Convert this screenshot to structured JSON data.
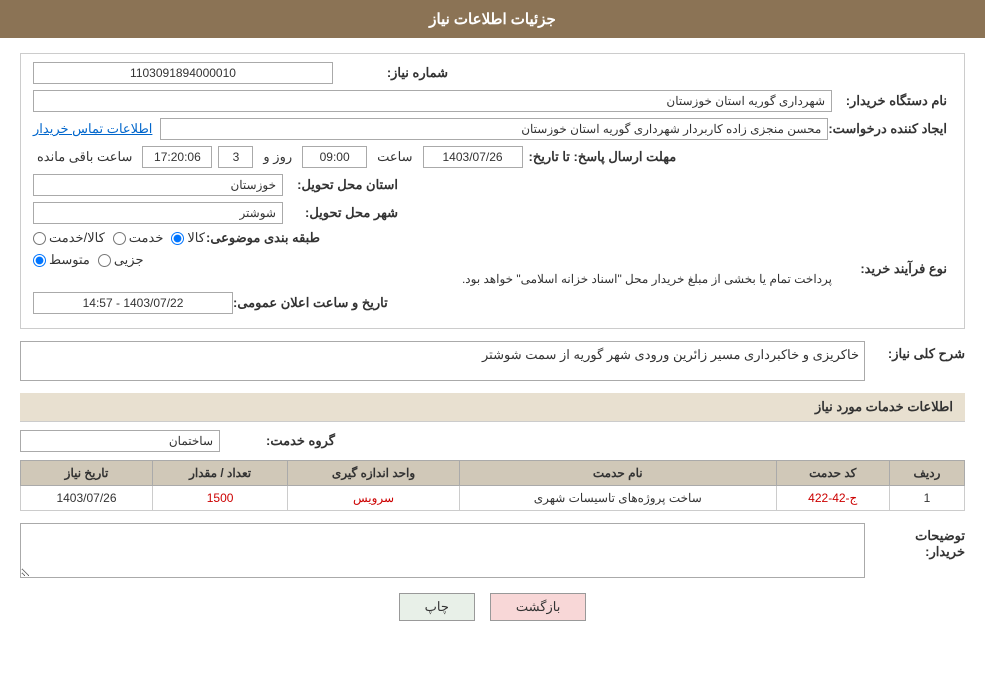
{
  "page": {
    "title": "جزئیات اطلاعات نیاز",
    "sections": {
      "need_details": {
        "fields": {
          "need_number_label": "شماره نیاز:",
          "need_number_value": "1103091894000010",
          "buyer_org_label": "نام دستگاه خریدار:",
          "buyer_org_value": "شهرداری گوریه استان خوزستان",
          "creator_label": "ایجاد کننده درخواست:",
          "creator_value": "محسن منجزی زاده کاربردار شهرداری گوریه استان خوزستان",
          "creator_contact": "اطلاعات تماس خریدار",
          "deadline_label": "مهلت ارسال پاسخ: تا تاریخ:",
          "deadline_date": "1403/07/26",
          "deadline_time_label": "ساعت",
          "deadline_time": "09:00",
          "deadline_days_label": "روز و",
          "deadline_days": "3",
          "deadline_remaining_label": "ساعت باقی مانده",
          "deadline_remaining": "17:20:06",
          "province_label": "استان محل تحویل:",
          "province_value": "خوزستان",
          "city_label": "شهر محل تحویل:",
          "city_value": "شوشتر",
          "category_label": "طبقه بندی موضوعی:",
          "category_options": [
            "کالا",
            "خدمت",
            "کالا/خدمت"
          ],
          "category_selected": "کالا",
          "purchase_type_label": "نوع فرآیند خرید:",
          "purchase_options": [
            "جزیی",
            "متوسط"
          ],
          "purchase_selected": "متوسط",
          "purchase_note": "پرداخت تمام یا بخشی از مبلغ خریدار محل \"اسناد خزانه اسلامی\" خواهد بود.",
          "announce_date_label": "تاریخ و ساعت اعلان عمومی:",
          "announce_date_value": "1403/07/22 - 14:57",
          "description_label": "شرح کلی نیاز:",
          "description_value": "خاکریزی و خاکبرداری مسیر زائرین ورودی شهر گوریه از سمت شوشتر"
        }
      },
      "services_info": {
        "title": "اطلاعات خدمات مورد نیاز",
        "service_group_label": "گروه خدمت:",
        "service_group_value": "ساختمان",
        "table": {
          "headers": [
            "ردیف",
            "کد حدمت",
            "نام حدمت",
            "واحد اندازه گیری",
            "تعداد / مقدار",
            "تاریخ نیاز"
          ],
          "rows": [
            {
              "row": "1",
              "code": "ج-42-422",
              "name": "ساخت پروژه‌های تاسیسات شهری",
              "unit": "سرویس",
              "quantity": "1500",
              "date": "1403/07/26"
            }
          ]
        }
      },
      "buyer_notes": {
        "label": "توضیحات خریدار:",
        "value": ""
      }
    },
    "buttons": {
      "back_label": "بازگشت",
      "print_label": "چاپ"
    }
  }
}
